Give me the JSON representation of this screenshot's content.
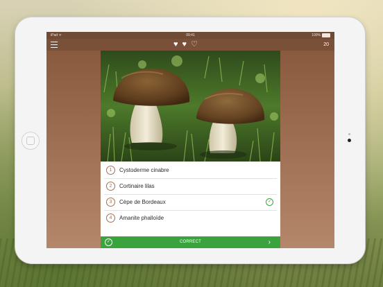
{
  "status_bar": {
    "device": "iPad ᯤ",
    "time": "09:41",
    "battery": "100%"
  },
  "nav": {
    "menu_icon": "hamburger-icon",
    "hearts": [
      "♥",
      "♥",
      "♡"
    ],
    "score": "20"
  },
  "question": {
    "image": "two-porcini-mushrooms-on-moss",
    "answers": [
      {
        "number": "1",
        "label": "Cystoderme cinabre",
        "correct": false
      },
      {
        "number": "2",
        "label": "Cortinaire lilas",
        "correct": false
      },
      {
        "number": "3",
        "label": "Cèpe de Bordeaux",
        "correct": true
      },
      {
        "number": "4",
        "label": "Amanite phalloïde",
        "correct": false
      }
    ],
    "check_glyph": "✓"
  },
  "result": {
    "label": "CORRECT",
    "check_glyph": "✓",
    "next_glyph": "›"
  },
  "colors": {
    "accent": "#a36f52",
    "success": "#3aa33d",
    "header": "#7a5038"
  }
}
